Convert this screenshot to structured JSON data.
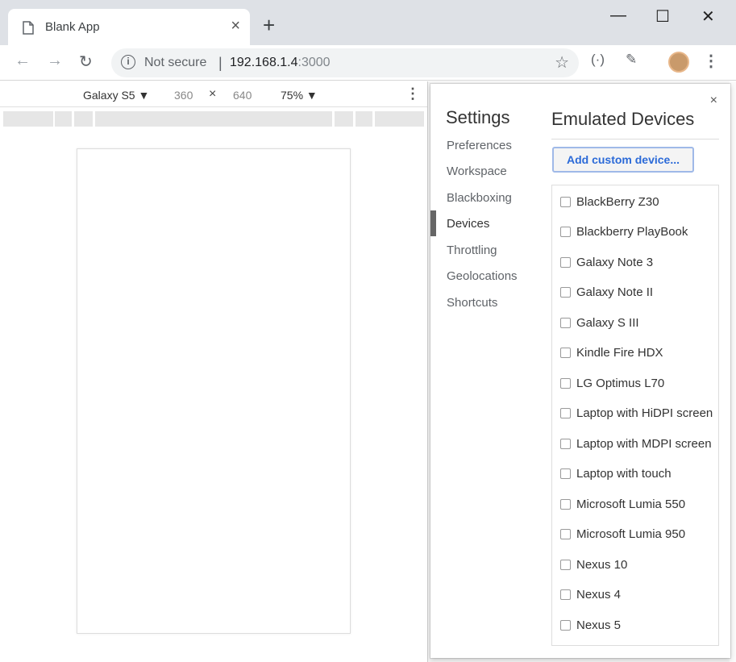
{
  "browser": {
    "tab_title": "Blank App",
    "new_tab_label": "+",
    "window_controls": {
      "minimize": "—",
      "maximize": "☐",
      "close": "✕"
    },
    "not_secure_label": "Not secure",
    "url_host": "192.168.1.4",
    "url_port": ":3000"
  },
  "device_toolbar": {
    "device": "Galaxy S5 ▼",
    "width": "360",
    "times": "×",
    "height": "640",
    "zoom": "75% ▼"
  },
  "settings": {
    "heading": "Settings",
    "close_label": "×",
    "nav": [
      "Preferences",
      "Workspace",
      "Blackboxing",
      "Devices",
      "Throttling",
      "Geolocations",
      "Shortcuts"
    ],
    "active_nav": "Devices",
    "panel_title": "Emulated Devices",
    "add_button": "Add custom device...",
    "devices": [
      "BlackBerry Z30",
      "Blackberry PlayBook",
      "Galaxy Note 3",
      "Galaxy Note II",
      "Galaxy S III",
      "Kindle Fire HDX",
      "LG Optimus L70",
      "Laptop with HiDPI screen",
      "Laptop with MDPI screen",
      "Laptop with touch",
      "Microsoft Lumia 550",
      "Microsoft Lumia 950",
      "Nexus 10",
      "Nexus 4",
      "Nexus 5"
    ]
  }
}
